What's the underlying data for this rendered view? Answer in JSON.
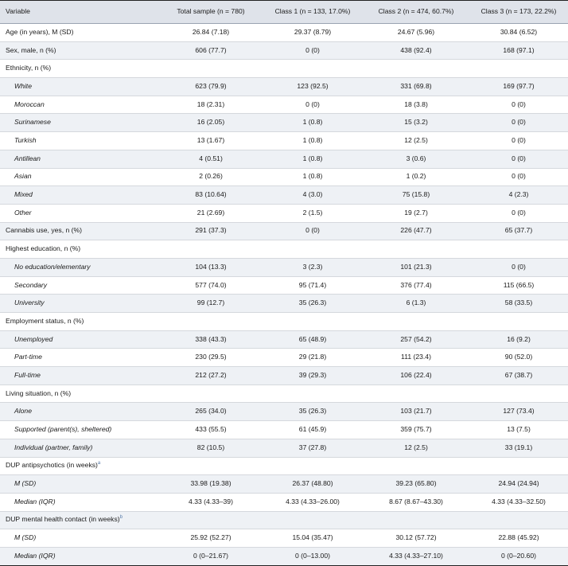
{
  "table": {
    "columns": [
      "Variable",
      "Total sample (n = 780)",
      "Class 1 (n = 133, 17.0%)",
      "Class 2 (n = 474, 60.7%)",
      "Class 3 (n = 173, 22.2%)"
    ],
    "rows": [
      {
        "label": "Age (in years), M (SD)",
        "values": [
          "26.84 (7.18)",
          "29.37 (8.79)",
          "24.67 (5.96)",
          "30.84 (6.52)"
        ]
      },
      {
        "label": "Sex, male, n (%)",
        "values": [
          "606 (77.7)",
          "0 (0)",
          "438 (92.4)",
          "168 (97.1)"
        ]
      },
      {
        "label": "Ethnicity, n (%)",
        "values": [
          "",
          "",
          "",
          ""
        ]
      },
      {
        "label": "White",
        "sub": true,
        "values": [
          "623 (79.9)",
          "123 (92.5)",
          "331 (69.8)",
          "169 (97.7)"
        ]
      },
      {
        "label": "Moroccan",
        "sub": true,
        "values": [
          "18 (2.31)",
          "0 (0)",
          "18 (3.8)",
          "0 (0)"
        ]
      },
      {
        "label": "Surinamese",
        "sub": true,
        "values": [
          "16 (2.05)",
          "1 (0.8)",
          "15 (3.2)",
          "0 (0)"
        ]
      },
      {
        "label": "Turkish",
        "sub": true,
        "values": [
          "13 (1.67)",
          "1 (0.8)",
          "12 (2.5)",
          "0 (0)"
        ]
      },
      {
        "label": "Antillean",
        "sub": true,
        "values": [
          "4 (0.51)",
          "1 (0.8)",
          "3 (0.6)",
          "0 (0)"
        ]
      },
      {
        "label": "Asian",
        "sub": true,
        "values": [
          "2 (0.26)",
          "1 (0.8)",
          "1 (0.2)",
          "0 (0)"
        ]
      },
      {
        "label": "Mixed",
        "sub": true,
        "values": [
          "83 (10.64)",
          "4 (3.0)",
          "75 (15.8)",
          "4 (2.3)"
        ]
      },
      {
        "label": "Other",
        "sub": true,
        "values": [
          "21 (2.69)",
          "2 (1.5)",
          "19 (2.7)",
          "0 (0)"
        ]
      },
      {
        "label": "Cannabis use, yes, n (%)",
        "values": [
          "291 (37.3)",
          "0 (0)",
          "226 (47.7)",
          "65 (37.7)"
        ]
      },
      {
        "label": "Highest education, n (%)",
        "values": [
          "",
          "",
          "",
          ""
        ]
      },
      {
        "label": "No education/elementary",
        "sub": true,
        "values": [
          "104 (13.3)",
          "3 (2.3)",
          "101 (21.3)",
          "0 (0)"
        ]
      },
      {
        "label": "Secondary",
        "sub": true,
        "values": [
          "577 (74.0)",
          "95 (71.4)",
          "376 (77.4)",
          "115 (66.5)"
        ]
      },
      {
        "label": "University",
        "sub": true,
        "values": [
          "99 (12.7)",
          "35 (26.3)",
          "6 (1.3)",
          "58 (33.5)"
        ]
      },
      {
        "label": "Employment status, n (%)",
        "values": [
          "",
          "",
          "",
          ""
        ]
      },
      {
        "label": "Unemployed",
        "sub": true,
        "values": [
          "338 (43.3)",
          "65 (48.9)",
          "257 (54.2)",
          "16 (9.2)"
        ]
      },
      {
        "label": "Part-time",
        "sub": true,
        "values": [
          "230 (29.5)",
          "29 (21.8)",
          "111 (23.4)",
          "90 (52.0)"
        ]
      },
      {
        "label": "Full-time",
        "sub": true,
        "values": [
          "212 (27.2)",
          "39 (29.3)",
          "106 (22.4)",
          "67 (38.7)"
        ]
      },
      {
        "label": "Living situation, n (%)",
        "values": [
          "",
          "",
          "",
          ""
        ]
      },
      {
        "label": "Alone",
        "sub": true,
        "values": [
          "265 (34.0)",
          "35 (26.3)",
          "103 (21.7)",
          "127 (73.4)"
        ]
      },
      {
        "label": "Supported (parent(s), sheltered)",
        "sub": true,
        "values": [
          "433 (55.5)",
          "61 (45.9)",
          "359 (75.7)",
          "13 (7.5)"
        ]
      },
      {
        "label": "Individual (partner, family)",
        "sub": true,
        "values": [
          "82 (10.5)",
          "37 (27.8)",
          "12 (2.5)",
          "33 (19.1)"
        ]
      },
      {
        "label": "DUP antipsychotics (in weeks)",
        "sup": "a",
        "values": [
          "",
          "",
          "",
          ""
        ]
      },
      {
        "label": "M (SD)",
        "sub": true,
        "values": [
          "33.98 (19.38)",
          "26.37 (48.80)",
          "39.23 (65.80)",
          "24.94 (24.94)"
        ]
      },
      {
        "label": "Median (IQR)",
        "sub": true,
        "values": [
          "4.33 (4.33–39)",
          "4.33 (4.33–26.00)",
          "8.67 (8.67–43.30)",
          "4.33 (4.33–32.50)"
        ]
      },
      {
        "label": "DUP mental health contact (in weeks)",
        "sup": "b",
        "values": [
          "",
          "",
          "",
          ""
        ]
      },
      {
        "label": "M (SD)",
        "sub": true,
        "values": [
          "25.92 (52.27)",
          "15.04 (35.47)",
          "30.12 (57.72)",
          "22.88 (45.92)"
        ]
      },
      {
        "label": "Median (IQR)",
        "sub": true,
        "values": [
          "0 (0–21.67)",
          "0 (0–13.00)",
          "4.33 (4.33–27.10)",
          "0 (0–20.60)"
        ]
      }
    ]
  }
}
